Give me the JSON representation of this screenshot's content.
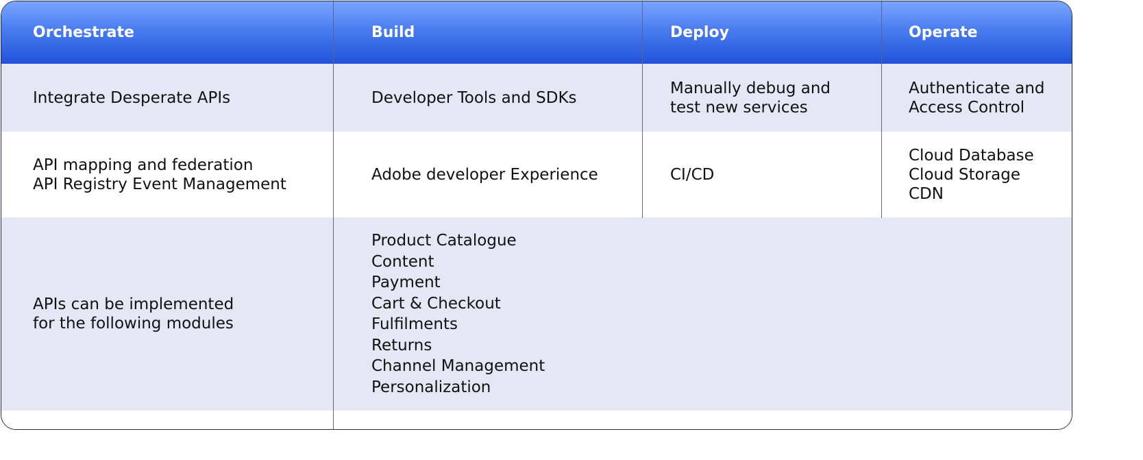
{
  "header": {
    "col1": "Orchestrate",
    "col2": "Build",
    "col3": "Deploy",
    "col4": "Operate"
  },
  "row1": {
    "col1": [
      "Integrate Desperate APIs"
    ],
    "col2": [
      "Developer Tools and SDKs"
    ],
    "col3": [
      "Manually debug and",
      "test new services"
    ],
    "col4": [
      "Authenticate and",
      "Access Control"
    ]
  },
  "row2": {
    "col1": [
      "API mapping and federation",
      "API Registry Event Management"
    ],
    "col2": [
      "Adobe developer Experience"
    ],
    "col3": [
      "CI/CD"
    ],
    "col4": [
      "Cloud Database",
      "Cloud Storage",
      "CDN"
    ]
  },
  "row3": {
    "col1": [
      "APIs can be implemented",
      "for the following modules"
    ],
    "modules": [
      "Product Catalogue",
      "Content",
      "Payment",
      "Cart & Checkout",
      "Fulfilments",
      "Returns",
      "Channel Management",
      "Personalization"
    ]
  },
  "colors": {
    "header_top": "#7aa6ff",
    "header_bottom": "#1f52d9",
    "shaded_row": "#e5e8f4",
    "border": "#1c2a4a"
  }
}
